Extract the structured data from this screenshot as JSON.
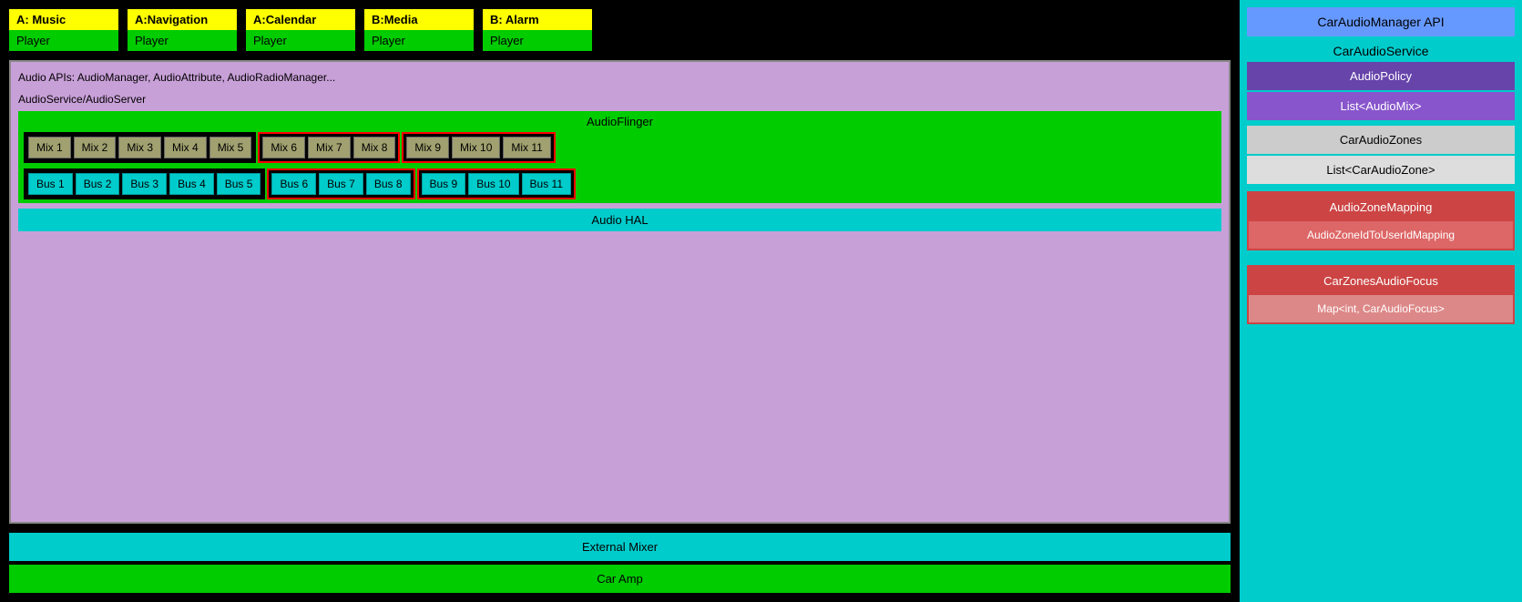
{
  "appCards": [
    {
      "top": "A: Music",
      "bottom": "Player"
    },
    {
      "top": "A:Navigation",
      "bottom": "Player"
    },
    {
      "top": "A:Calendar",
      "bottom": "Player"
    },
    {
      "top": "B:Media",
      "bottom": "Player"
    },
    {
      "top": "B: Alarm",
      "bottom": "Player"
    }
  ],
  "archLabels": {
    "audioAPIs": "Audio APIs: AudioManager, AudioAttribute, AudioRadioManager...",
    "audioService": "AudioService/AudioServer",
    "audioFlinger": "AudioFlinger",
    "audioHAL": "Audio HAL",
    "externalMixer": "External Mixer",
    "carAmp": "Car Amp"
  },
  "mixZones": [
    {
      "bordered": false,
      "mixes": [
        "Mix 1",
        "Mix 2",
        "Mix 3",
        "Mix 4",
        "Mix 5"
      ],
      "buses": [
        "Bus 1",
        "Bus 2",
        "Bus 3",
        "Bus 4",
        "Bus 5"
      ]
    },
    {
      "bordered": true,
      "mixes": [
        "Mix 6",
        "Mix 7",
        "Mix 8"
      ],
      "buses": [
        "Bus 6",
        "Bus 7",
        "Bus 8"
      ]
    },
    {
      "bordered": true,
      "mixes": [
        "Mix 9",
        "Mix 10",
        "Mix 11"
      ],
      "buses": [
        "Bus 9",
        "Bus 10",
        "Bus 11"
      ]
    }
  ],
  "rightPanel": {
    "carAudioManagerAPI": "CarAudioManager API",
    "carAudioService": "CarAudioService",
    "audioPolicy": "AudioPolicy",
    "listAudioMix": "List<AudioMix>",
    "carAudioZones": "CarAudioZones",
    "listCarAudioZone": "List<CarAudioZone>",
    "audioZoneMapping": "AudioZoneMapping",
    "audioZoneIdToUserIdMapping": "AudioZoneIdToUserIdMapping",
    "carZonesAudioFocus": "CarZonesAudioFocus",
    "mapCarAudioFocus": "Map<int, CarAudioFocus>"
  }
}
